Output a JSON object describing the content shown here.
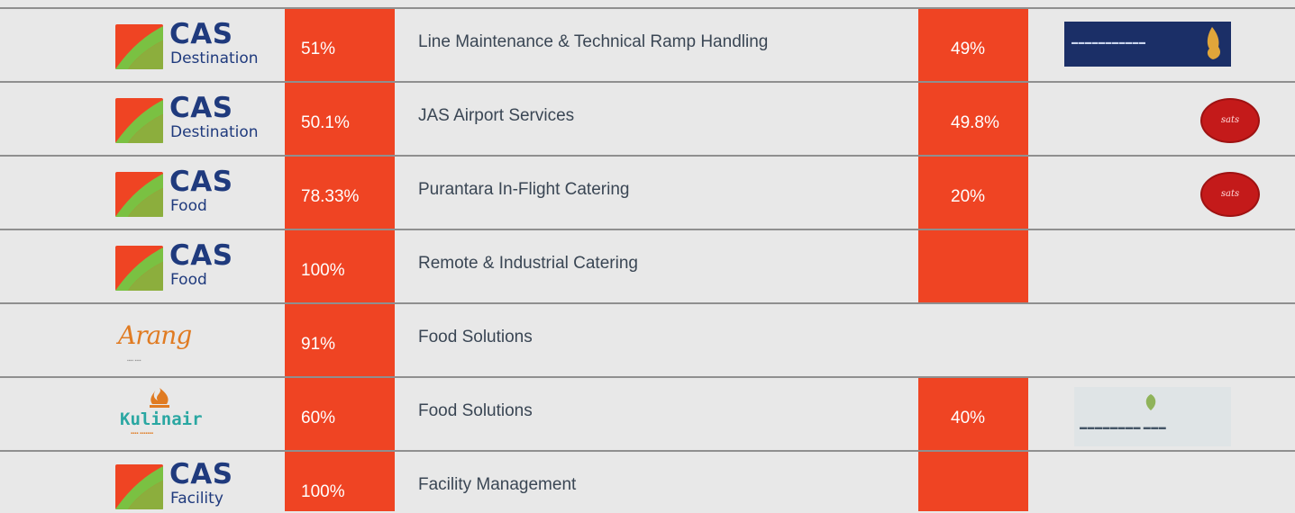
{
  "rows": [
    {
      "logo": {
        "type": "cas",
        "name": "CAS",
        "sub": "Destination"
      },
      "share": "51%",
      "business": "Line Maintenance & Technical Ramp Handling",
      "partner_share": "49%",
      "partner_logo": "sia-engineering-logo"
    },
    {
      "logo": {
        "type": "cas",
        "name": "CAS",
        "sub": "Destination"
      },
      "share": "50.1%",
      "business": "JAS Airport Services",
      "partner_share": "49.8%",
      "partner_logo": "sats-red-logo"
    },
    {
      "logo": {
        "type": "cas",
        "name": "CAS",
        "sub": "Food"
      },
      "share": "78.33%",
      "business": "Purantara In-Flight Catering",
      "partner_share": "20%",
      "partner_logo": "sats-red-logo"
    },
    {
      "logo": {
        "type": "cas",
        "name": "CAS",
        "sub": "Food"
      },
      "share": "100%",
      "business": "Remote & Industrial Catering",
      "partner_share": "",
      "partner_logo": ""
    },
    {
      "logo": {
        "type": "arang",
        "name": "Arang"
      },
      "share": "91%",
      "business": "Food Solutions",
      "partner_share": "",
      "partner_logo": ""
    },
    {
      "logo": {
        "type": "kulinair",
        "name": "Kulinair"
      },
      "share": "60%",
      "business": "Food Solutions",
      "partner_share": "40%",
      "partner_logo": "anglia-logo"
    },
    {
      "logo": {
        "type": "cas",
        "name": "CAS",
        "sub": "Facility"
      },
      "share": "100%",
      "business": "Facility Management",
      "partner_share": "",
      "partner_logo": ""
    }
  ],
  "colors": {
    "accent": "#ef4423",
    "background": "#e8e8e8",
    "cas_blue": "#1f3a7d",
    "cas_green": "#7ac142",
    "divider": "#8f8f8f"
  }
}
